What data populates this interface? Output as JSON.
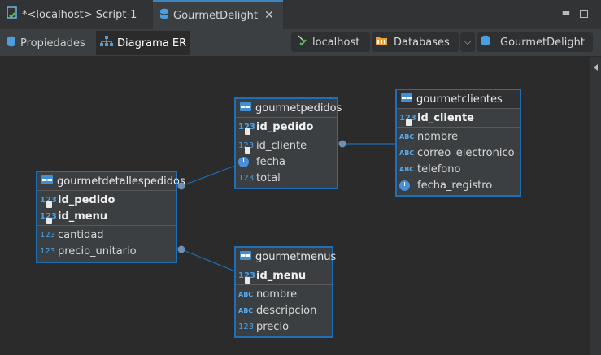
{
  "tabs": [
    {
      "label": "*<localhost> Script-1",
      "icon": "sql-script-icon"
    },
    {
      "label": "GourmetDelight",
      "icon": "database-icon",
      "active": true
    }
  ],
  "subtabs": [
    {
      "label": "Propiedades",
      "icon": "database-icon"
    },
    {
      "label": "Diagrama ER",
      "icon": "er-diagram-icon",
      "active": true
    }
  ],
  "breadcrumb": {
    "connection": "localhost",
    "databases": "Databases",
    "database": "GourmetDelight"
  },
  "entities": {
    "gourmetpedidos": {
      "name": "gourmetpedidos",
      "pk": [
        {
          "name": "id_pedido",
          "type": "123"
        }
      ],
      "cols": [
        {
          "name": "id_cliente",
          "type": "123"
        },
        {
          "name": "fecha",
          "type": "date"
        },
        {
          "name": "total",
          "type": "123"
        }
      ]
    },
    "gourmetclientes": {
      "name": "gourmetclientes",
      "pk": [
        {
          "name": "id_cliente",
          "type": "123"
        }
      ],
      "cols": [
        {
          "name": "nombre",
          "type": "ABC"
        },
        {
          "name": "correo_electronico",
          "type": "ABC"
        },
        {
          "name": "telefono",
          "type": "ABC"
        },
        {
          "name": "fecha_registro",
          "type": "date"
        }
      ]
    },
    "gourmetdetallespedidos": {
      "name": "gourmetdetallespedidos",
      "pk": [
        {
          "name": "id_pedido",
          "type": "123"
        },
        {
          "name": "id_menu",
          "type": "123"
        }
      ],
      "cols": [
        {
          "name": "cantidad",
          "type": "123"
        },
        {
          "name": "precio_unitario",
          "type": "123"
        }
      ]
    },
    "gourmetmenus": {
      "name": "gourmetmenus",
      "pk": [
        {
          "name": "id_menu",
          "type": "123"
        }
      ],
      "cols": [
        {
          "name": "nombre",
          "type": "ABC"
        },
        {
          "name": "descripcion",
          "type": "ABC"
        },
        {
          "name": "precio",
          "type": "123"
        }
      ]
    }
  },
  "colors": {
    "accent": "#1d6fb7",
    "background": "#2b2b2b",
    "entity_bg": "#3c3f41"
  }
}
